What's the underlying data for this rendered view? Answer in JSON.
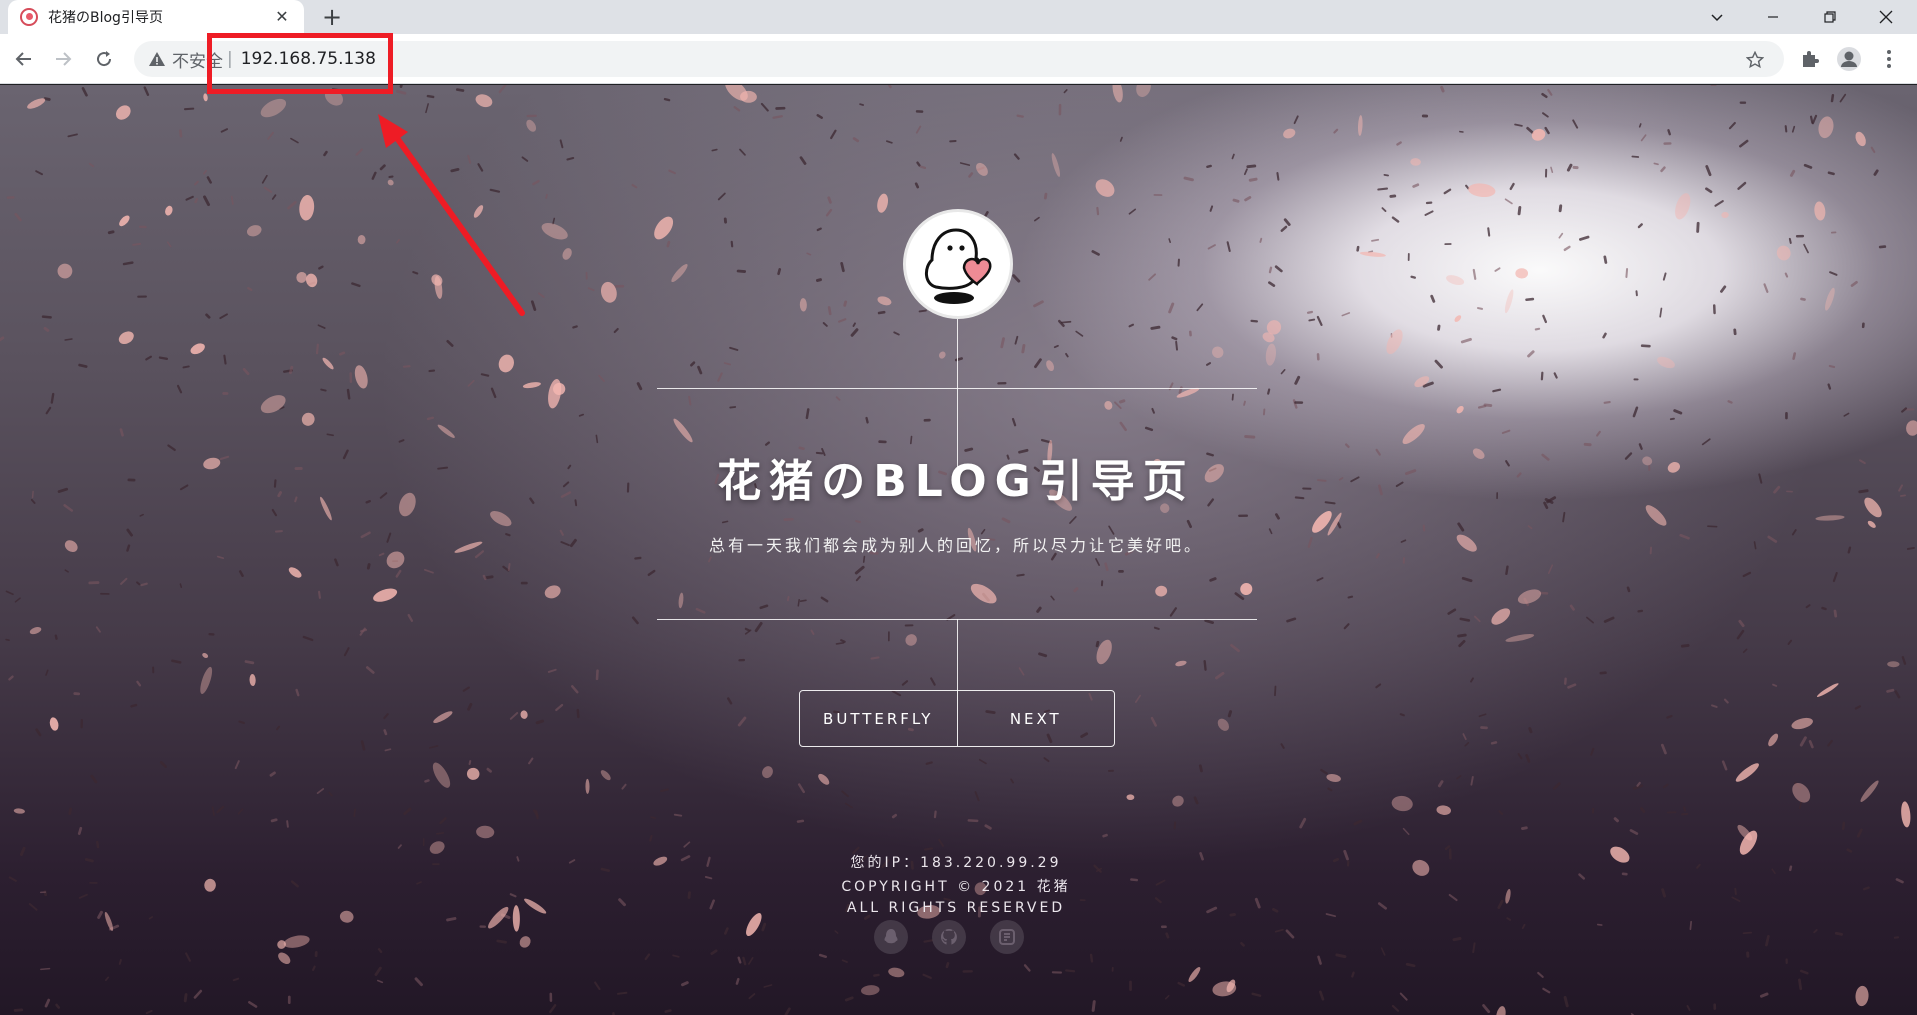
{
  "browser": {
    "tab": {
      "title": "花猪のBlog引导页",
      "favicon": "pig-heart-favicon"
    },
    "new_tab": "+",
    "window_controls": [
      "minimize",
      "restore",
      "close"
    ],
    "security_label": "不安全",
    "separator": "|",
    "url": "192.168.75.138",
    "toolbar_icons": [
      "back-arrow",
      "forward-arrow",
      "reload",
      "bookmark-star",
      "extensions-puzzle",
      "profile-avatar",
      "menu-dots"
    ]
  },
  "annotation": {
    "color": "#ee1c25",
    "type": "red-box-and-arrow"
  },
  "page": {
    "title": "花猪のBLOG引导页",
    "subtitle": "总有一天我们都会成为别人的回忆，所以尽力让它美好吧。",
    "buttons": [
      {
        "label": "BUTTERFLY"
      },
      {
        "label": "NEXT"
      }
    ],
    "footer": {
      "ip": "您的IP：183.220.99.29",
      "copyright": "COPYRIGHT © 2021 花猪",
      "rights": "ALL RIGHTS RESERVED"
    },
    "social_icons": [
      "qq-icon",
      "github-icon",
      "blog-icon"
    ],
    "colors": {
      "petal": "#f3b6b0",
      "text": "#ffffff",
      "background_dark": "#2c1f30"
    }
  }
}
